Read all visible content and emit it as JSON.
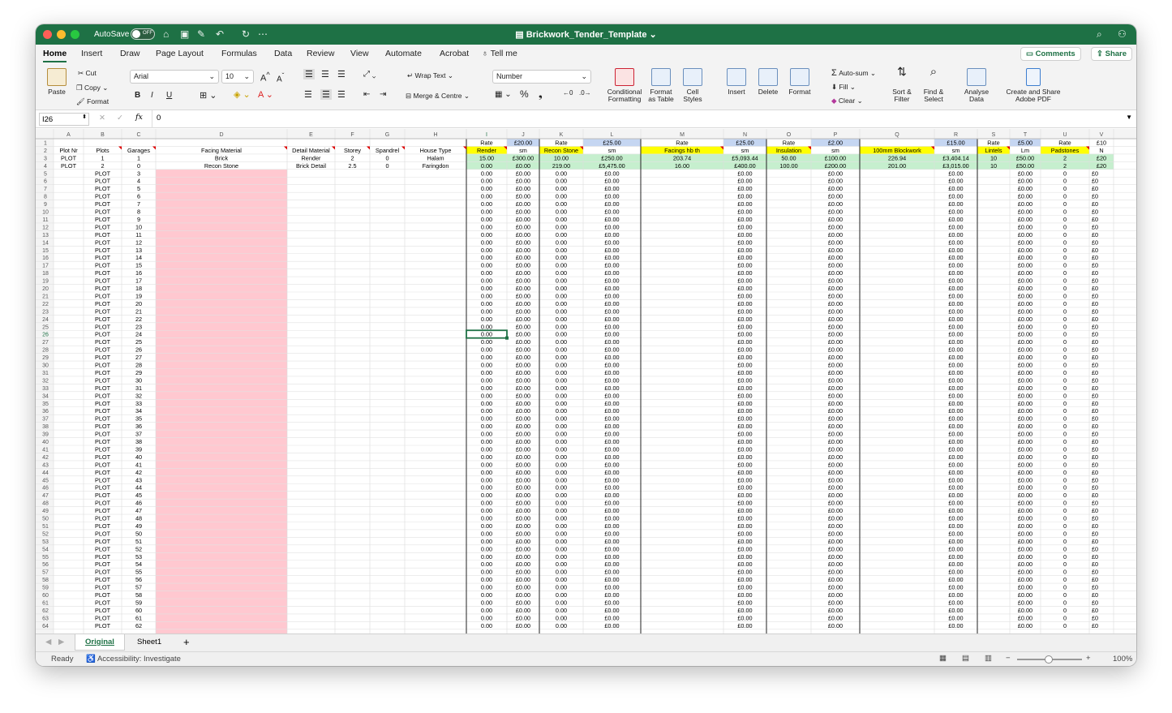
{
  "window": {
    "title": "Brickwork_Tender_Template",
    "autosave": "AutoSave",
    "toggle": "OFF"
  },
  "tabs": [
    "Home",
    "Insert",
    "Draw",
    "Page Layout",
    "Formulas",
    "Data",
    "Review",
    "View",
    "Automate",
    "Acrobat",
    "Tell me"
  ],
  "buttons": {
    "comments": "Comments",
    "share": "Share"
  },
  "ribbon": {
    "paste": "Paste",
    "cut": "Cut",
    "copy": "Copy",
    "format": "Format",
    "font": "Arial",
    "size": "10",
    "bold": "B",
    "italic": "I",
    "underline": "U",
    "wrap": "Wrap Text",
    "merge": "Merge & Centre",
    "numfmt": "Number",
    "percent": "%",
    "cond": [
      "Conditional",
      "Formatting"
    ],
    "fmt_table": [
      "Format",
      "as Table"
    ],
    "cell_styles": [
      "Cell",
      "Styles"
    ],
    "insert": "Insert",
    "delete": "Delete",
    "format2": "Format",
    "autosum": "Auto-sum",
    "fill": "Fill",
    "clear": "Clear",
    "sort": [
      "Sort &",
      "Filter"
    ],
    "find": [
      "Find &",
      "Select"
    ],
    "analyse": [
      "Analyse",
      "Data"
    ],
    "pdf": [
      "Create and Share",
      "Adobe PDF"
    ]
  },
  "formula": {
    "cell": "I26",
    "fx": "fx",
    "value": "0"
  },
  "sheet": {
    "cols": [
      "A",
      "B",
      "C",
      "D",
      "E",
      "F",
      "G",
      "H",
      "I",
      "J",
      "K",
      "L",
      "M",
      "N",
      "O",
      "P",
      "Q",
      "R",
      "S",
      "T",
      "U",
      "V"
    ],
    "row1": {
      "I": "Rate",
      "J": "£20.00",
      "K": "Rate",
      "L": "£25.00",
      "M": "Rate",
      "N": "£25.00",
      "O": "Rate",
      "P": "£2.00",
      "R": "£15.00",
      "S": "Rate",
      "T": "£5.00",
      "U": "Rate",
      "V": "£10"
    },
    "row2": {
      "A": "Plot Nr",
      "B": "Plots",
      "C": "Garages",
      "D": "Facing Material",
      "E": "Detail Material",
      "F": "Storey",
      "G": "Spandrel",
      "H": "House Type",
      "I": "Render",
      "J": "sm",
      "K": "Recon Stone",
      "L": "sm",
      "M": "Facings hb th",
      "N": "sm",
      "O": "Insulation",
      "P": "sm",
      "Q": "100mm Blockwork",
      "R": "sm",
      "S": "Lintels",
      "T": "Lm",
      "U": "Padstones",
      "V": "N"
    },
    "row3": {
      "A": "PLOT",
      "B": "1",
      "C": "1",
      "D": "Brick",
      "E": "Render",
      "F": "2",
      "G": "0",
      "H": "Halam",
      "I": "15.00",
      "J": "£300.00",
      "K": "10.00",
      "L": "£250.00",
      "M": "203.74",
      "N": "£5,093.44",
      "O": "50.00",
      "P": "£100.00",
      "Q": "226.94",
      "R": "£3,404.14",
      "S": "10",
      "T": "£50.00",
      "U": "2",
      "V": "£20"
    },
    "row4": {
      "A": "PLOT",
      "B": "2",
      "C": "0",
      "D": "Recon Stone",
      "E": "Brick Detail",
      "F": "2.5",
      "G": "0",
      "H": "Faringdon",
      "I": "0.00",
      "J": "£0.00",
      "K": "219.00",
      "L": "£5,475.00",
      "M": "16.00",
      "N": "£400.00",
      "O": "100.00",
      "P": "£200.00",
      "Q": "201.00",
      "R": "£3,015.00",
      "S": "10",
      "T": "£50.00",
      "U": "2",
      "V": "£20"
    },
    "plot_label": "PLOT",
    "zero": "0.00",
    "zero_money": "£0.00",
    "int_zero": "0",
    "last_row": 64
  },
  "sheets": [
    "Original",
    "Sheet1"
  ],
  "add_sheet": "+",
  "status": {
    "ready": "Ready",
    "accessibility": "Accessibility: Investigate",
    "zoom": "100%"
  }
}
